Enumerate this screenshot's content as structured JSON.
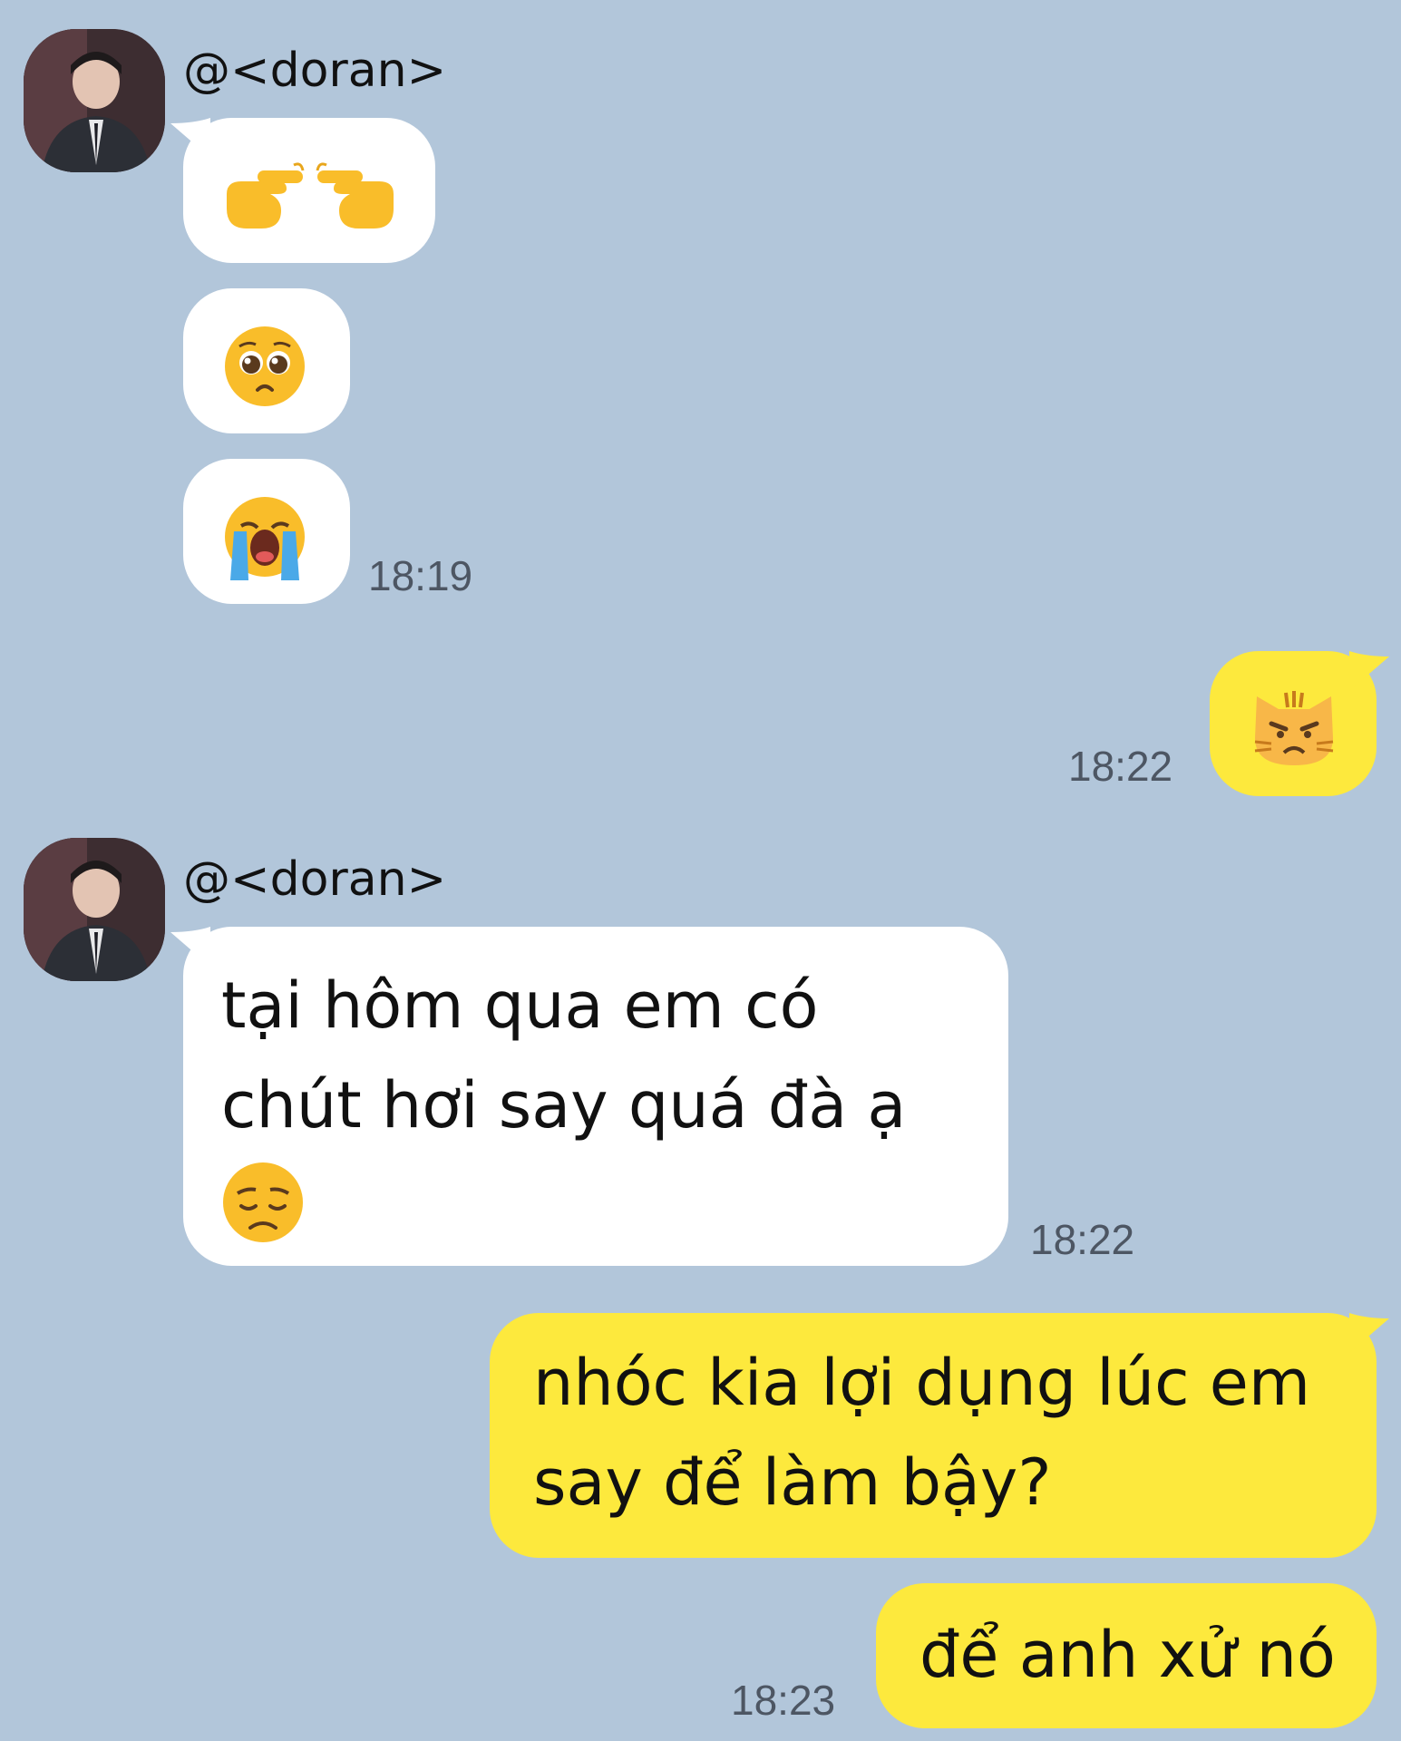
{
  "chat": {
    "sender_name": "@<doran>",
    "messages": [
      {
        "id": "m1",
        "dir": "in",
        "emoji": "pointing-fingers",
        "emoji_text": "👉👈"
      },
      {
        "id": "m2",
        "dir": "in",
        "emoji": "pleading-face",
        "emoji_text": "🥺"
      },
      {
        "id": "m3",
        "dir": "in",
        "emoji": "loudly-crying-face",
        "emoji_text": "😭",
        "time": "18:19"
      },
      {
        "id": "m4",
        "dir": "out",
        "emoji": "pouting-cat-face",
        "emoji_text": "😾",
        "time": "18:22"
      },
      {
        "id": "m5",
        "dir": "in",
        "line1": "tại hôm qua em có",
        "line2": "chút hơi say quá đà ạ",
        "emoji": "disappointed-face",
        "emoji_text": "😞",
        "time": "18:22"
      },
      {
        "id": "m6",
        "dir": "out",
        "line1": "nhóc kia lợi dụng lúc em",
        "line2": "say để làm bậy?"
      },
      {
        "id": "m7",
        "dir": "out",
        "line1": "để anh xử nó",
        "time": "18:23"
      }
    ]
  },
  "colors": {
    "background": "#b2c6da",
    "incoming_bubble": "#ffffff",
    "outgoing_bubble": "#fde93d",
    "emoji_yellow": "#f9bd2a"
  }
}
